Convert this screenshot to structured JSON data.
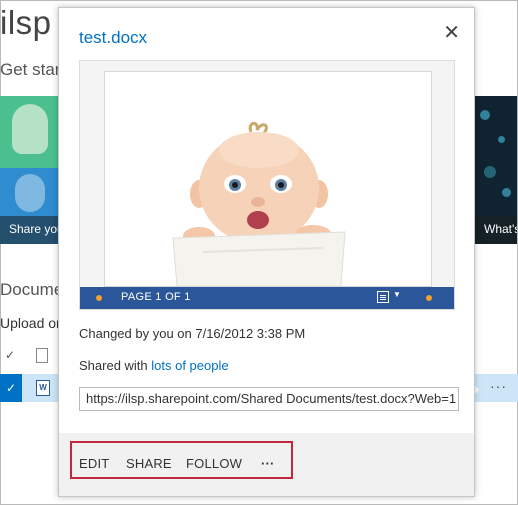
{
  "site": {
    "title": "ilsp Team Site",
    "get_started": "Get started with your site",
    "tile_left_caption": "Share your site.",
    "tile_right_caption": "What's",
    "documents_heading": "Documents",
    "upload_text": "Upload or drag files here"
  },
  "callout": {
    "title": "test.docx",
    "close_glyph": "✕",
    "preview": {
      "page_label": "PAGE 1 OF 1"
    },
    "changed_text": "Changed by you on 7/16/2012 3:38 PM",
    "shared_prefix": "Shared with ",
    "shared_link": "lots of people",
    "url": "https://ilsp.sharepoint.com/Shared Documents/test.docx?Web=1",
    "actions": {
      "edit": "EDIT",
      "share": "SHARE",
      "follow": "FOLLOW",
      "more": "···"
    }
  },
  "list": {
    "row_more": "···",
    "check_glyph": "✓",
    "doc_icon_letter": "W"
  },
  "colors": {
    "accent": "#0072c6",
    "preview_bar": "#2b579a",
    "highlight_box": "#c0283c"
  }
}
